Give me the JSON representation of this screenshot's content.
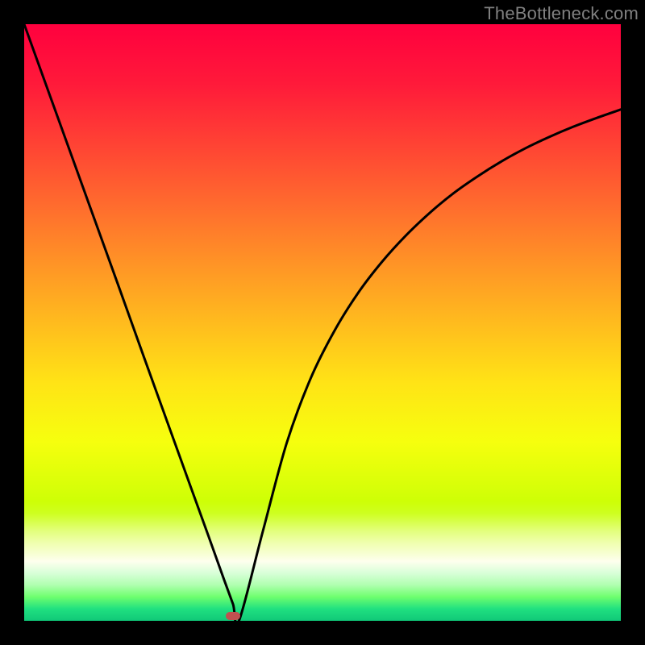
{
  "watermark": "TheBottleneck.com",
  "chart_data": {
    "type": "line",
    "title": "",
    "xlabel": "",
    "ylabel": "",
    "xlim": [
      0,
      1
    ],
    "ylim": [
      0,
      1
    ],
    "series": [
      {
        "name": "curve",
        "x": [
          0.0,
          0.04,
          0.08,
          0.12,
          0.16,
          0.2,
          0.24,
          0.28,
          0.31,
          0.335,
          0.35,
          0.36,
          0.4,
          0.44,
          0.48,
          0.52,
          0.56,
          0.6,
          0.64,
          0.68,
          0.72,
          0.76,
          0.8,
          0.84,
          0.88,
          0.92,
          0.96,
          1.0
        ],
        "y": [
          1.0,
          0.889,
          0.778,
          0.667,
          0.556,
          0.444,
          0.333,
          0.222,
          0.139,
          0.069,
          0.028,
          0.0,
          0.15,
          0.298,
          0.406,
          0.486,
          0.55,
          0.602,
          0.646,
          0.684,
          0.717,
          0.745,
          0.77,
          0.792,
          0.811,
          0.828,
          0.843,
          0.857
        ]
      }
    ],
    "marker": {
      "x": 0.35,
      "y": 0.008,
      "color": "#c05050"
    },
    "gradient_stops": [
      {
        "pos": 0.0,
        "color": "#ff003e"
      },
      {
        "pos": 0.5,
        "color": "#ffbb1e"
      },
      {
        "pos": 0.8,
        "color": "#ceff06"
      },
      {
        "pos": 0.9,
        "color": "#feffee"
      },
      {
        "pos": 1.0,
        "color": "#10c878"
      }
    ]
  }
}
